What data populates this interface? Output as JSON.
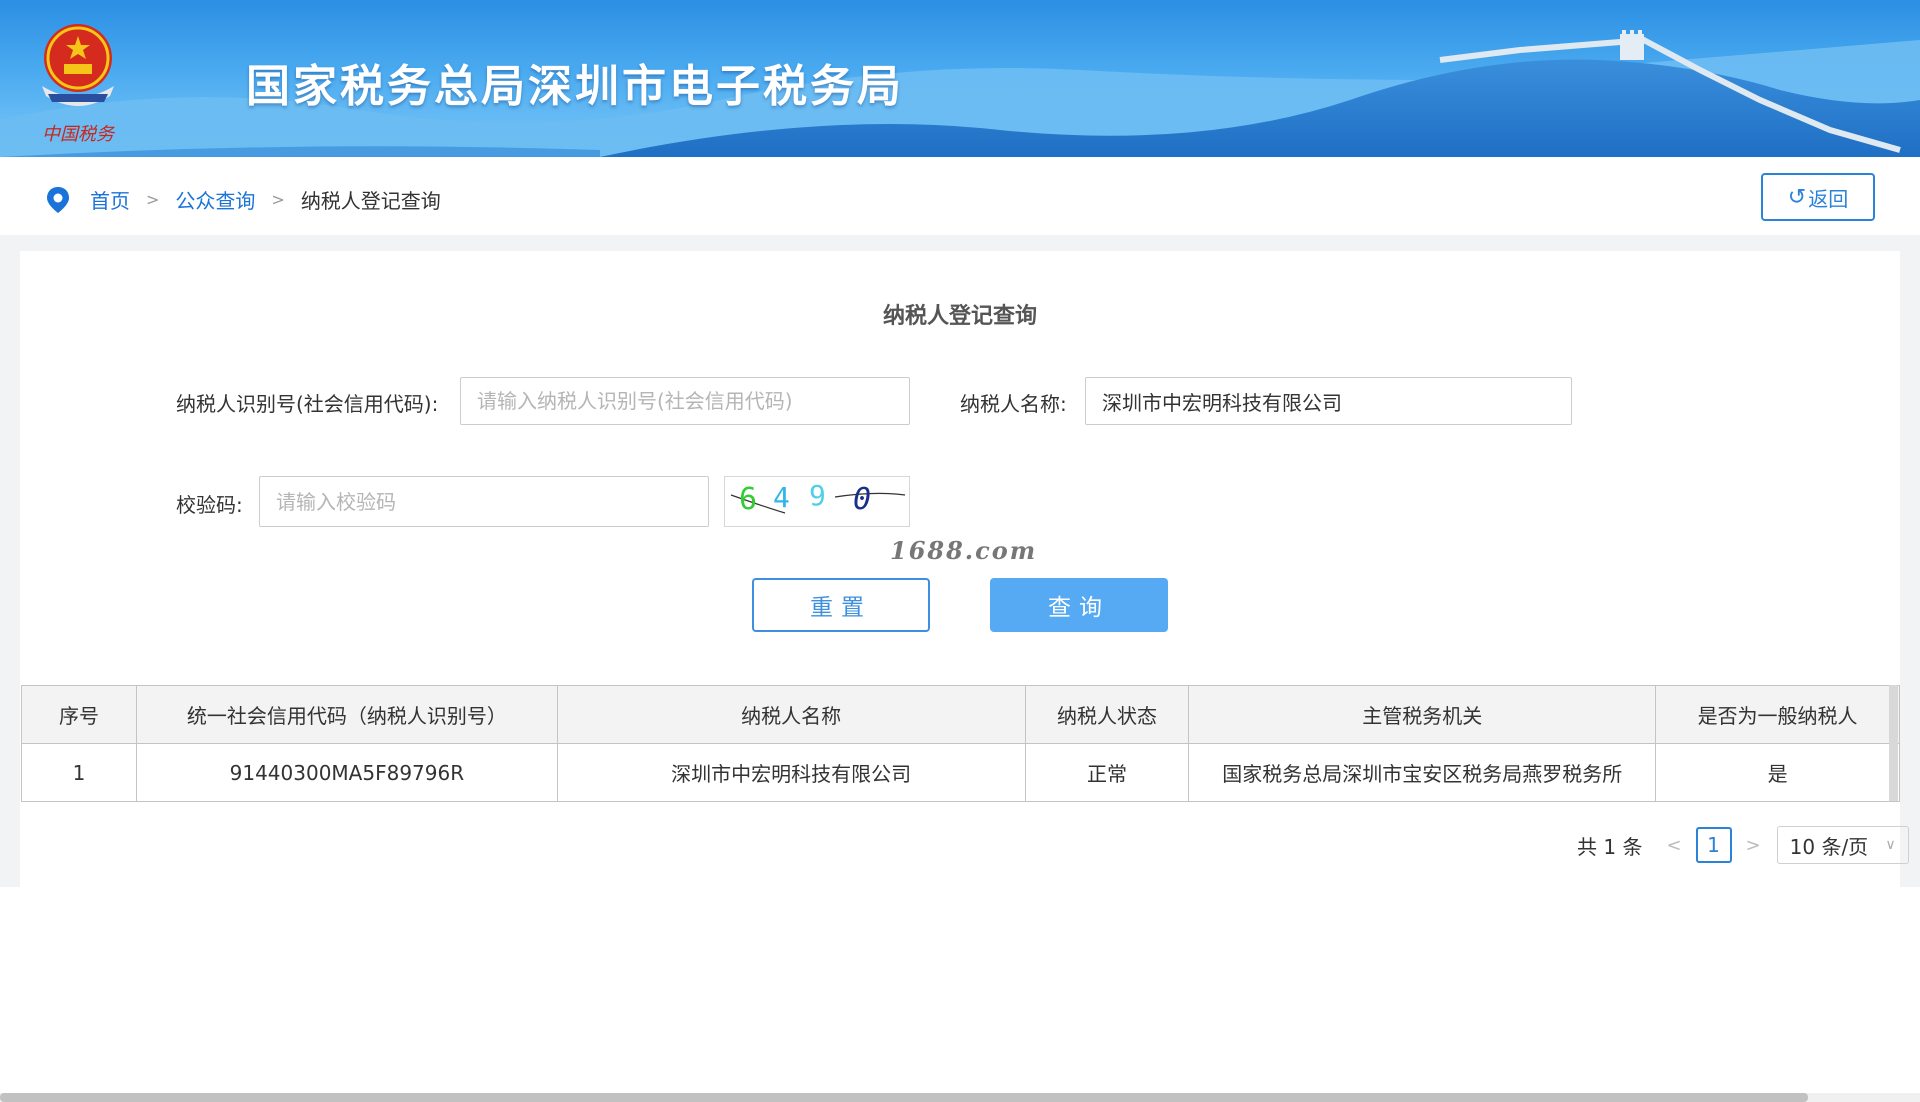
{
  "header": {
    "title": "国家税务总局深圳市电子税务局",
    "emblem_caption": "中国税务"
  },
  "breadcrumb": {
    "home": "首页",
    "public_query": "公众查询",
    "current": "纳税人登记查询",
    "separator": ">"
  },
  "back_button": {
    "icon": "↺",
    "label": "返回"
  },
  "form": {
    "title": "纳税人登记查询",
    "taxpayer_id_label": "纳税人识别号(社会信用代码):",
    "taxpayer_id_placeholder": "请输入纳税人识别号(社会信用代码)",
    "taxpayer_id_value": "",
    "taxpayer_name_label": "纳税人名称:",
    "taxpayer_name_value": "深圳市中宏明科技有限公司",
    "captcha_label": "校验码:",
    "captcha_placeholder": "请输入校验码",
    "captcha_value": "",
    "captcha_chars": [
      "6",
      "4",
      "9",
      "0"
    ],
    "reset_label": "重置",
    "query_label": "查询"
  },
  "watermark": "1688.com",
  "table": {
    "headers": [
      "序号",
      "统一社会信用代码（纳税人识别号）",
      "纳税人名称",
      "纳税人状态",
      "主管税务机关",
      "是否为一般纳税人"
    ],
    "rows": [
      [
        "1",
        "91440300MA5F89796R",
        "深圳市中宏明科技有限公司",
        "正常",
        "国家税务总局深圳市宝安区税务局燕罗税务所",
        "是"
      ]
    ]
  },
  "pagination": {
    "total_text": "共 1 条",
    "prev": "<",
    "current_page": "1",
    "next": ">",
    "page_size": "10 条/页"
  },
  "colors": {
    "banner": "#4aaaf0",
    "link": "#1a73d9",
    "primary_button": "#55aaf3",
    "outline_button": "#3d8fe0"
  }
}
